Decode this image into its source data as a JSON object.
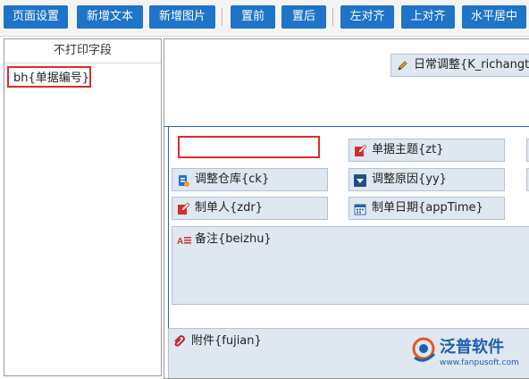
{
  "toolbar": {
    "page_setup": "页面设置",
    "new_text": "新增文本",
    "new_image": "新增图片",
    "bring_front": "置前",
    "send_back": "置后",
    "align_left": "左对齐",
    "align_top": "上对齐",
    "center_horizontal": "水平居中"
  },
  "left_panel": {
    "title": "不打印字段",
    "items": [
      {
        "label": "bh{单据编号}"
      }
    ]
  },
  "canvas": {
    "fields": {
      "title_field": "日常调整{K_richangtia",
      "subject": "单据主题{zt}",
      "warehouse": "调整仓库{ck}",
      "reason": "调整原因{yy}",
      "creator": "制单人{zdr}",
      "date": "制单日期{appTime}",
      "remark": "备注{beizhu}",
      "attachment": "附件{fujian}"
    }
  },
  "watermark": {
    "brand": "泛普软件",
    "url": "www.fanpusoft.com"
  },
  "colors": {
    "toolbar_button": "#1f73c8",
    "field_bg": "#dfe7f0",
    "highlight_red": "#e02a2a",
    "guide_blue": "#2468c2"
  }
}
